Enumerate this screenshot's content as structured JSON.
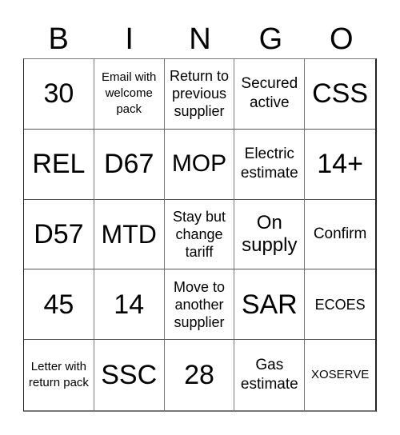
{
  "header": {
    "letters": [
      "B",
      "I",
      "N",
      "G",
      "O"
    ]
  },
  "grid": {
    "cells": [
      [
        "30",
        "Email with welcome pack",
        "Return to previous supplier",
        "Secured active",
        "CSS"
      ],
      [
        "REL",
        "D67",
        "MOP",
        "Electric estimate",
        "14+"
      ],
      [
        "D57",
        "MTD",
        "Stay but change tariff",
        "On supply",
        "Confirm"
      ],
      [
        "45",
        "14",
        "Move to another supplier",
        "SAR",
        "ECOES"
      ],
      [
        "Letter with return pack",
        "SSC",
        "28",
        "Gas estimate",
        "XOSERVE"
      ]
    ]
  }
}
